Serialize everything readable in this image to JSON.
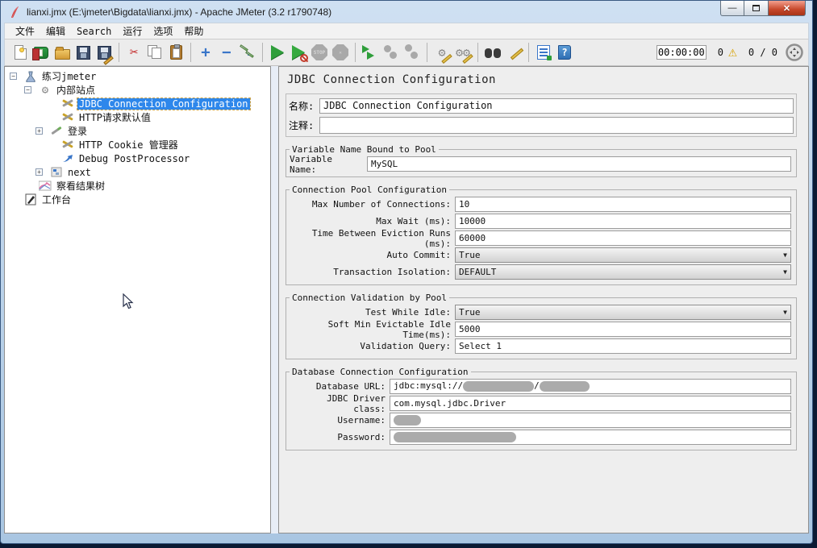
{
  "window": {
    "title": "lianxi.jmx (E:\\jmeter\\Bigdata\\lianxi.jmx) - Apache JMeter (3.2 r1790748)",
    "controls": {
      "minimize": "—",
      "close": "✕"
    }
  },
  "menu": {
    "items": [
      "文件",
      "编辑",
      "Search",
      "运行",
      "选项",
      "帮助"
    ]
  },
  "toolbar": {
    "glyphs": {
      "expand": "+",
      "collapse": "−",
      "cut": "✂",
      "gear": "⚙",
      "stop": "STOP",
      "x": "✕",
      "help": "?",
      "warning": "⚠",
      "combo_arrow": "▼"
    },
    "timer": "00:00:00",
    "error_count": "0",
    "thread_count": "0 / 0"
  },
  "tree": {
    "items": [
      {
        "label": "练习jmeter",
        "icon": "test-plan",
        "toggle": "-"
      },
      {
        "label": "内部站点",
        "icon": "thread-group",
        "toggle": "-"
      },
      {
        "label": "JDBC Connection Configuration",
        "icon": "config-element",
        "selected": true
      },
      {
        "label": "HTTP请求默认值",
        "icon": "config-element"
      },
      {
        "label": "登录",
        "icon": "http-sampler",
        "toggle": "+"
      },
      {
        "label": "HTTP Cookie 管理器",
        "icon": "config-element"
      },
      {
        "label": "Debug PostProcessor",
        "icon": "post-processor"
      },
      {
        "label": "next",
        "icon": "controller",
        "toggle": "+"
      },
      {
        "label": "察看结果树",
        "icon": "view-results-tree"
      },
      {
        "label": "工作台",
        "icon": "workbench"
      }
    ],
    "toggle_minus": "−",
    "toggle_plus": "+"
  },
  "form": {
    "title": "JDBC Connection Configuration",
    "name": {
      "label": "名称:",
      "value": "JDBC Connection Configuration"
    },
    "comment": {
      "label": "注释:",
      "value": ""
    },
    "var_section": {
      "legend": "Variable Name Bound to Pool",
      "row": {
        "label": "Variable Name:",
        "value": "MySQL"
      }
    },
    "pool_section": {
      "legend": "Connection Pool Configuration",
      "rows": [
        {
          "label": "Max Number of Connections:",
          "value": "10",
          "type": "text"
        },
        {
          "label": "Max Wait (ms):",
          "value": "10000",
          "type": "text"
        },
        {
          "label": "Time Between Eviction Runs (ms):",
          "value": "60000",
          "type": "text"
        },
        {
          "label": "Auto Commit:",
          "value": "True",
          "type": "select"
        },
        {
          "label": "Transaction Isolation:",
          "value": "DEFAULT",
          "type": "select"
        }
      ]
    },
    "validation_section": {
      "legend": "Connection Validation by Pool",
      "rows": [
        {
          "label": "Test While Idle:",
          "value": "True",
          "type": "select"
        },
        {
          "label": "Soft Min Evictable Idle Time(ms):",
          "value": "5000",
          "type": "text"
        },
        {
          "label": "Validation Query:",
          "value": "Select 1",
          "type": "text"
        }
      ]
    },
    "db_section": {
      "legend": "Database Connection Configuration",
      "rows": [
        {
          "label": "Database URL:",
          "value_prefix": "jdbc:mysql://",
          "separator": "/",
          "redacted": true
        },
        {
          "label": "JDBC Driver class:",
          "value": "com.mysql.jdbc.Driver"
        },
        {
          "label": "Username:",
          "redacted": true
        },
        {
          "label": "Password:",
          "redacted": true
        }
      ]
    }
  },
  "colors": {
    "selection_blue": "#2e87eb",
    "titlebar_blue": "#bdd4ec",
    "warning_yellow": "#d8a200",
    "play_green": "#2f9e3b"
  }
}
